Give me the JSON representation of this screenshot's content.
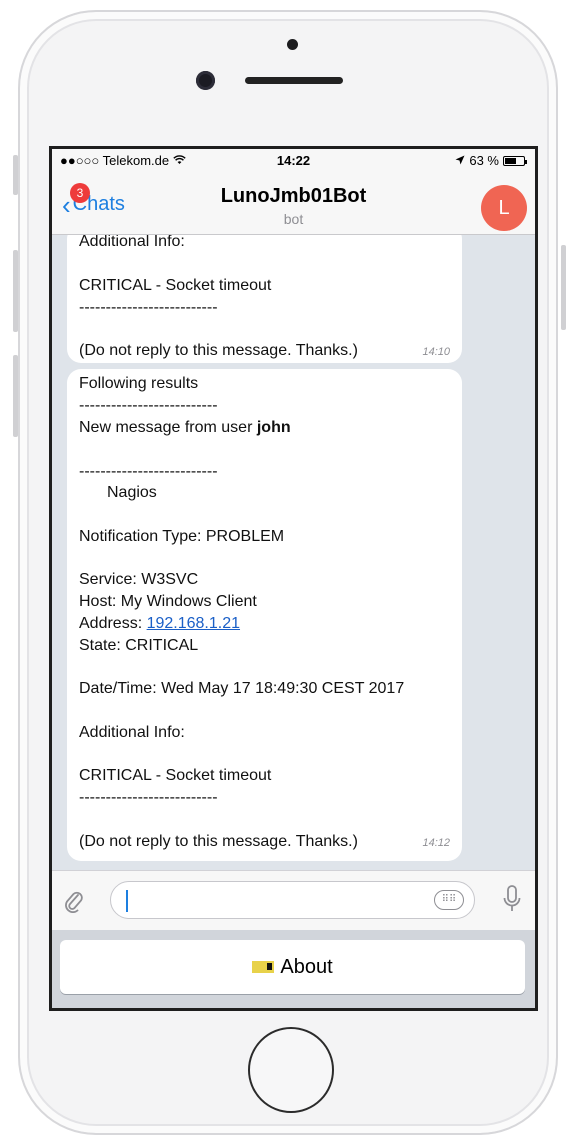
{
  "status_bar": {
    "carrier": "●●○○○ Telekom.de",
    "time": "14:22",
    "battery": "63 %",
    "battery_level": 0.63
  },
  "nav": {
    "back_label": "Chats",
    "unread_badge": "3",
    "title": "LunoJmb01Bot",
    "subtitle": "bot",
    "avatar_initial": "L"
  },
  "messages": [
    {
      "lines": [
        "Additional Info:",
        "",
        "CRITICAL - Socket timeout",
        "--------------------------",
        "",
        "(Do not reply to this message. Thanks.)"
      ],
      "time": "14:10"
    },
    {
      "line1": "Following results",
      "line2": "--------------------------",
      "line3_prefix": "New message from user ",
      "line3_user": "john",
      "line4": "--------------------------",
      "line5": "Nagios",
      "line6": "Notification Type: PROBLEM",
      "line7": "Service: W3SVC",
      "line8": "Host: My Windows Client",
      "line9_prefix": "Address: ",
      "line9_ip": "192.168.1.21",
      "line10": "State: CRITICAL",
      "line11": "Date/Time: Wed May 17 18:49:30 CEST 2017",
      "line12": "Additional Info:",
      "line13": "CRITICAL - Socket timeout",
      "line14": "--------------------------",
      "line15": "(Do not reply to this message. Thanks.)",
      "time": "14:12"
    }
  ],
  "keyboard": {
    "button_label": "About"
  },
  "icons": {
    "attach": "paperclip-icon",
    "keyboard": "keyboard-icon",
    "mic": "microphone-icon",
    "back": "chevron-left-icon",
    "location": "location-arrow-icon",
    "wifi": "wifi-icon"
  },
  "colors": {
    "accent": "#1d7fe0",
    "avatar": "#f06553",
    "badge": "#ee3b3b",
    "chat_background": "#dfe4ea"
  }
}
